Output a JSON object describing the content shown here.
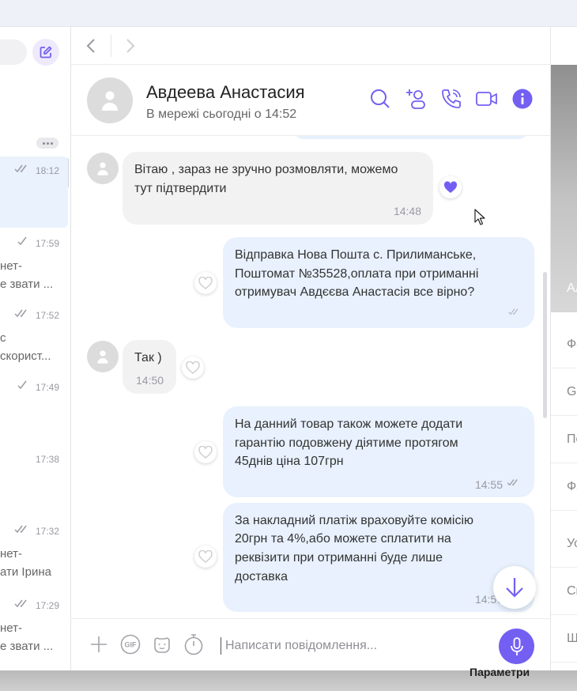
{
  "chat_list": {
    "rows": [
      {
        "time": "18:12",
        "line1": "",
        "line2": "",
        "status": "read"
      },
      {
        "time": "17:59",
        "line1": "нет-",
        "line2": "е звати ...",
        "status": "sent"
      },
      {
        "time": "17:52",
        "line1": "с",
        "line2": "скорист...",
        "status": "read"
      },
      {
        "time": "17:49",
        "line1": "",
        "line2": "",
        "status": "sent"
      },
      {
        "time": "17:38",
        "line1": "",
        "line2": "",
        "status": ""
      },
      {
        "time": "17:32",
        "line1": "нет-",
        "line2": "ати Ірина",
        "status": "read"
      },
      {
        "time": "17:29",
        "line1": "нет-",
        "line2": "е звати ...",
        "status": "read"
      }
    ]
  },
  "header": {
    "name": "Авдеева Анастасия",
    "presence": "В мережі сьогодні о 14:52"
  },
  "messages": [
    {
      "direction": "in",
      "text_lines": [
        "Вітаю , зараз не зручно розмовляти, можемо",
        "тут підтвердити"
      ],
      "time": "14:48",
      "liked": true
    },
    {
      "direction": "out",
      "text_lines": [
        "Відправка Нова Пошта с. Прилиманське,",
        "Поштомат №35528,оплата при отриманні",
        "отримувач Авдєєва Анастасія все вірно?"
      ],
      "time": "",
      "status": "sent"
    },
    {
      "direction": "in",
      "text_lines": [
        "Так )"
      ],
      "time": "14:50",
      "liked": false
    },
    {
      "direction": "out",
      "text_lines": [
        "На данний товар також можете додати",
        "гарантію подовжену діятиме протягом",
        "45днів ціна 107грн"
      ],
      "time": "14:55",
      "status": "read"
    },
    {
      "direction": "out",
      "text_lines": [
        "За накладний платіж враховуйте комісію",
        "20грн та 4%,або можете сплатити на",
        "реквізити при отриманні буде лише",
        "доставка"
      ],
      "time": "14:57",
      "status": ""
    }
  ],
  "composer": {
    "placeholder": "Написати повідомлення..."
  },
  "info_panel": {
    "photo_label": "Ал",
    "items": [
      "Фо",
      "GI",
      "По",
      "Фа",
      "Ус",
      "Сп",
      "Ш"
    ]
  },
  "footer": {
    "label": "Параметри"
  },
  "colors": {
    "accent": "#7360f2",
    "outgoing_bubble": "#e8f1fd",
    "incoming_bubble": "#f2f2f3",
    "active_row": "#eaf2fd"
  }
}
